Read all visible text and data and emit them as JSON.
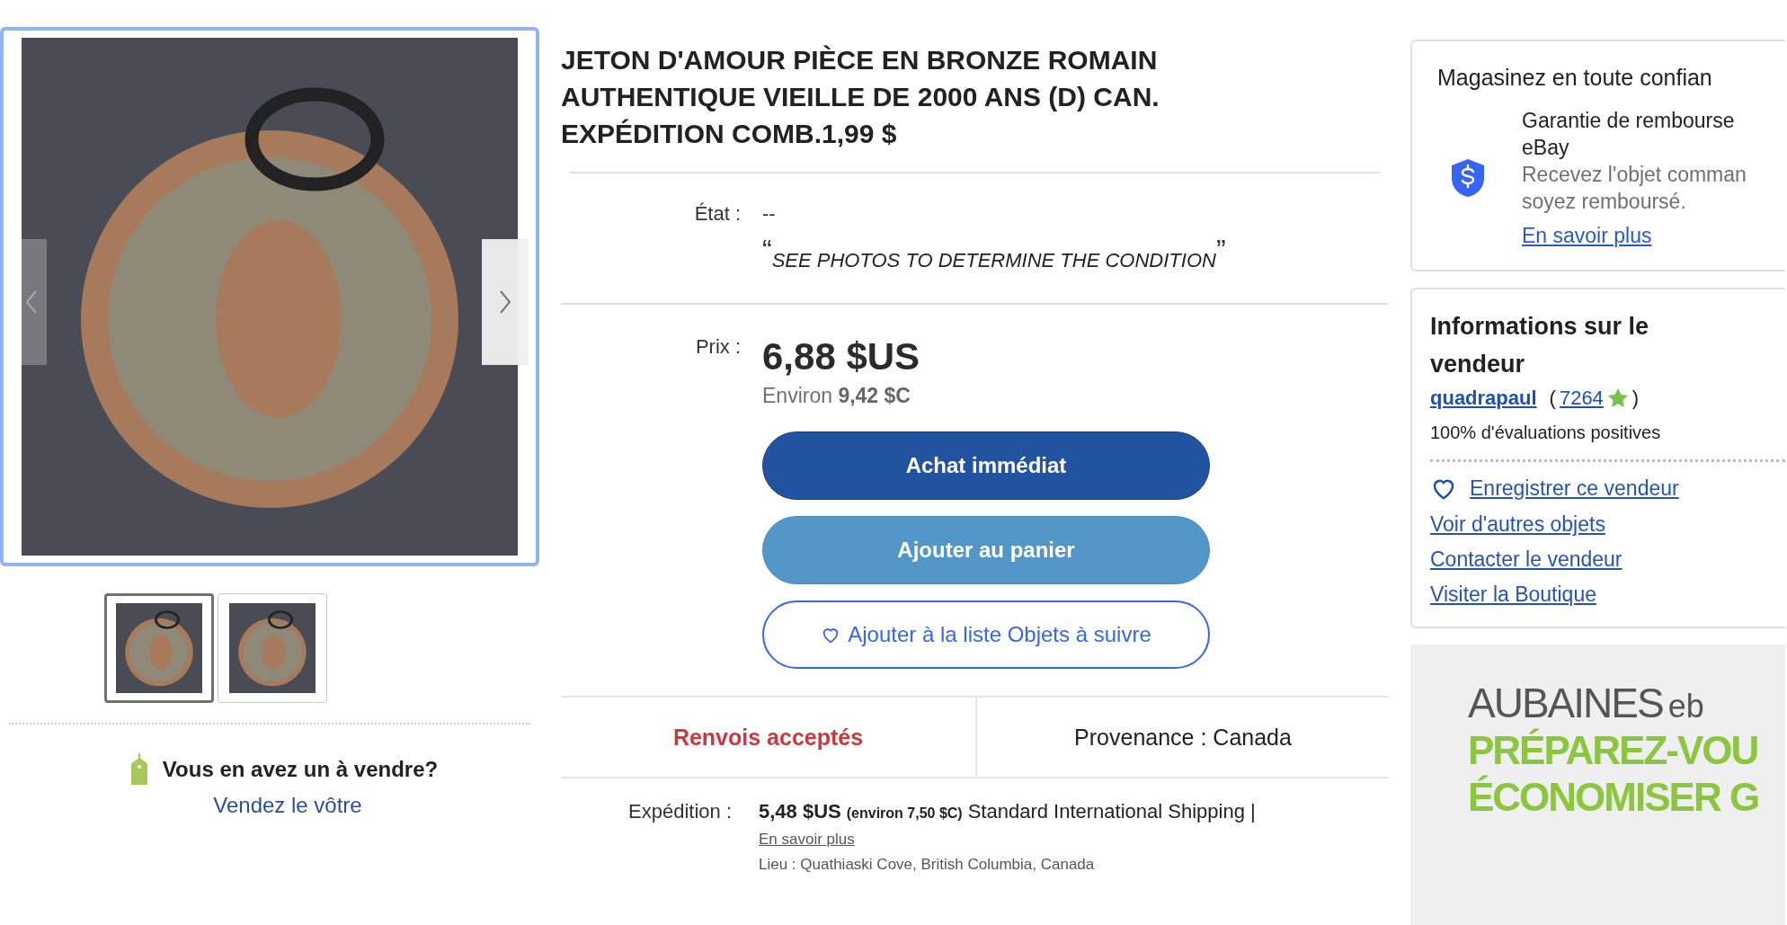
{
  "gallery": {
    "thumbnails": [
      {
        "selected": true
      },
      {
        "selected": false
      }
    ]
  },
  "sell_prompt": {
    "title": "Vous en avez un à vendre?",
    "link": "Vendez le vôtre"
  },
  "listing": {
    "title": "JETON D'AMOUR PIÈCE EN BRONZE ROMAIN AUTHENTIQUE VIEILLE DE 2000 ANS (D) CAN. EXPÉDITION COMB.1,99 $",
    "condition": {
      "label": "État :",
      "value": "--",
      "open_quote": "“",
      "note": "SEE PHOTOS TO DETERMINE THE CONDITION",
      "close_quote": "”"
    },
    "price": {
      "label": "Prix :",
      "amount": "6,88 $US",
      "approx": "Environ **9,42 $C**"
    },
    "buttons": [
      {
        "kind": "primary",
        "label": "Achat immédiat"
      },
      {
        "kind": "secondary",
        "label": "Ajouter au panier"
      },
      {
        "kind": "watch",
        "label": "Ajouter à la liste Objets à suivre"
      }
    ],
    "highlights": [
      {
        "kind": "alert",
        "text": "Renvois acceptés"
      },
      {
        "kind": "plain",
        "text": "Provenance : Canada"
      }
    ],
    "shipping": {
      "label": "Expédition :",
      "cost": "5,48 $US",
      "approx": "(environ 7,50 $C)",
      "service": "Standard International Shipping |",
      "link": "En savoir plus",
      "location": "Lieu : Quathiaski Cove, British Columbia, Canada"
    }
  },
  "trust_card": {
    "title": "Magasinez en toute confian",
    "guarantee_lines": [
      "Garantie de rembourse",
      "eBay"
    ],
    "description_lines": [
      "Recevez l'objet comman",
      "soyez remboursé."
    ],
    "link": "En savoir plus"
  },
  "seller": {
    "title": "Informations sur le vendeur",
    "name": "quadrapaul",
    "open_paren": "(",
    "score": "7264",
    "close_paren": ")",
    "positive": "100% d'évaluations positives",
    "links": [
      {
        "kind": "save",
        "text": "Enregistrer ce vendeur"
      },
      {
        "kind": "plain",
        "text": "Voir d'autres objets"
      },
      {
        "kind": "plain",
        "text": "Contacter le vendeur"
      },
      {
        "kind": "plain",
        "text": "Visiter la Boutique"
      }
    ]
  },
  "ad": {
    "brand": "AUBAINES",
    "logo": "eb",
    "headline_lines": [
      "PRÉPAREZ-VOU",
      "ÉCONOMISER G"
    ]
  }
}
